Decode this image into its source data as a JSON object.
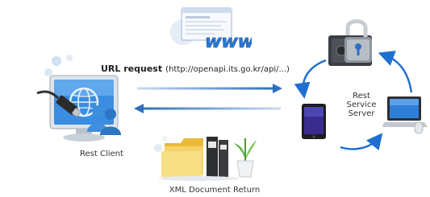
{
  "diagram": {
    "request_label": "URL request",
    "request_url": "(http://openapi.its.go.kr/api/...)",
    "client_label": "Rest Client",
    "server_label_lines": [
      "Rest",
      "Service",
      "Server"
    ],
    "return_label": "XML Document Return"
  },
  "icons": {
    "browser": "browser-window-icon",
    "www": "www-icon",
    "client_computer": "computer-monitor-icon",
    "usb_cable": "usb-cable-icon",
    "users": "users-icon",
    "safe": "padlock-safe-icon",
    "tablet": "tablet-icon",
    "laptop": "laptop-icon",
    "folders": "folders-icon",
    "plant": "plant-icon"
  },
  "colors": {
    "arrow_blue": "#2f6fc0",
    "cycle_blue": "#1f6fd0",
    "monitor_blue": "#3a8de0"
  }
}
